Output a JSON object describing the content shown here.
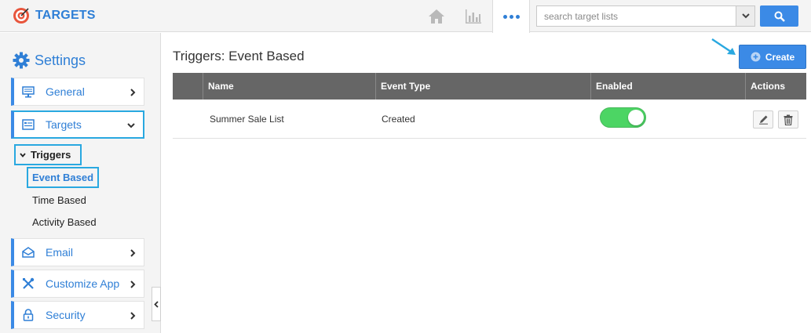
{
  "header": {
    "app_name": "TARGETS",
    "nav": [
      "home-icon",
      "analytics-icon",
      "more-icon"
    ],
    "search": {
      "placeholder": "search target lists",
      "value": ""
    }
  },
  "sidebar": {
    "title": "Settings",
    "items": [
      {
        "label": "General",
        "icon": "monitor-icon"
      },
      {
        "label": "Targets",
        "icon": "list-icon",
        "expanded": true
      },
      {
        "label": "Email",
        "icon": "envelope-icon"
      },
      {
        "label": "Customize App",
        "icon": "tools-icon"
      },
      {
        "label": "Security",
        "icon": "lock-icon"
      }
    ],
    "submenu": {
      "group": "Triggers",
      "links": [
        "Event Based",
        "Time Based",
        "Activity Based"
      ],
      "active": "Event Based"
    }
  },
  "main": {
    "title": "Triggers: Event Based",
    "create_label": "Create",
    "columns": [
      "",
      "Name",
      "Event Type",
      "Enabled",
      "Actions"
    ],
    "rows": [
      {
        "name": "Summer Sale List",
        "event_type": "Created",
        "enabled": true
      }
    ]
  },
  "colors": {
    "accent": "#3b8ae6",
    "highlight": "#29a8e0",
    "toggle_on": "#4cd564",
    "header_bg": "#666666"
  }
}
